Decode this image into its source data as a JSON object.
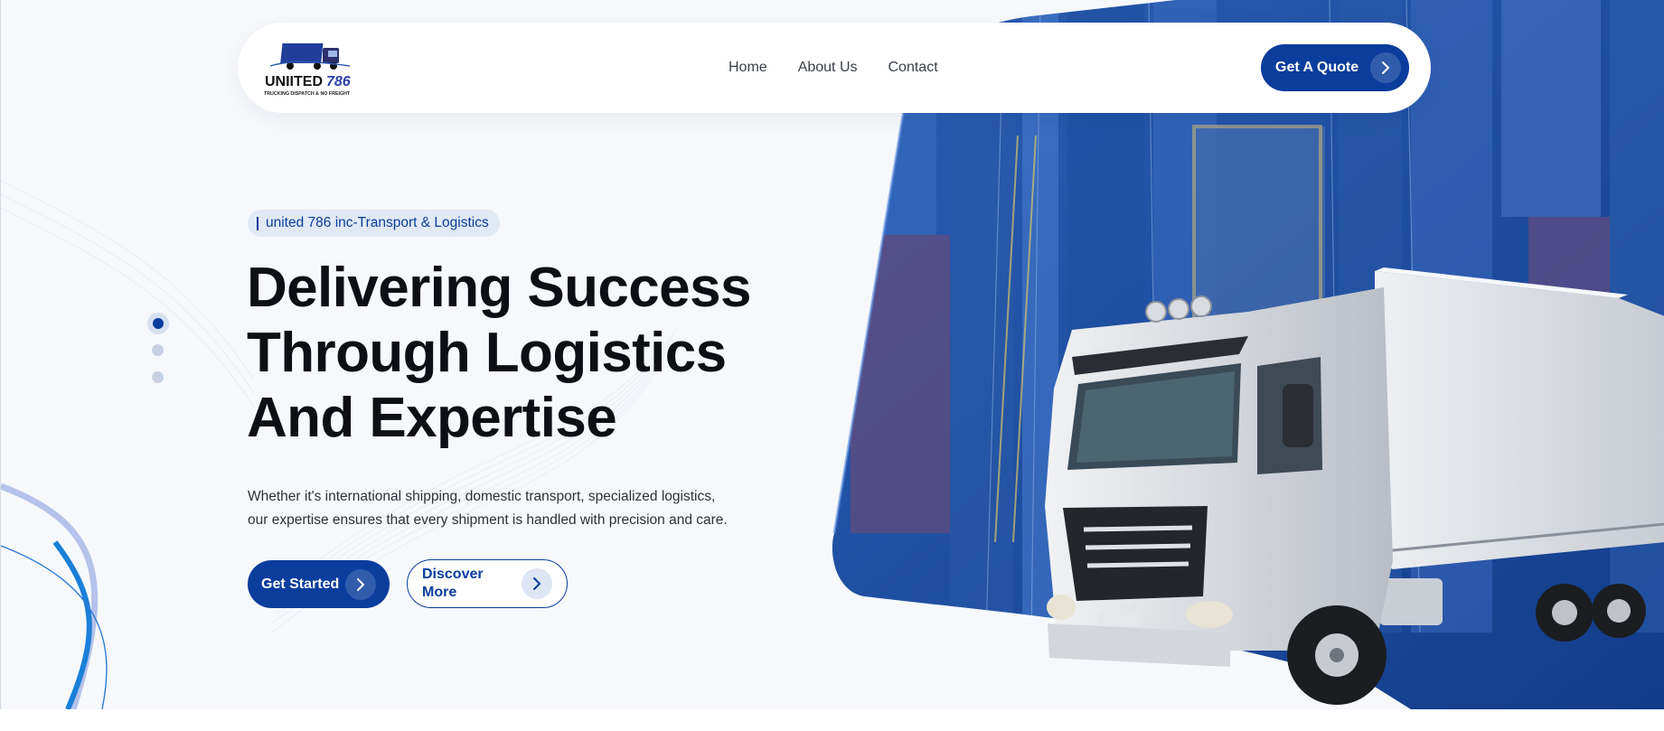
{
  "brand": {
    "name": "UNIITED 786",
    "tagline": "TRUCKING DISPATCH & NO FREIGHT"
  },
  "nav": {
    "items": [
      {
        "label": "Home"
      },
      {
        "label": "About Us"
      },
      {
        "label": "Contact"
      }
    ]
  },
  "header": {
    "quote_label": "Get A Quote"
  },
  "hero": {
    "tag": "united 786 inc-Transport & Logistics",
    "headline_lines": [
      "Delivering Success",
      "Through Logistics",
      "And Expertise"
    ],
    "subtext_lines": [
      "Whether it's international shipping, domestic transport, specialized logistics,",
      "our expertise ensures that every shipment is handled with precision and care."
    ],
    "primary_cta": "Get Started",
    "secondary_cta": "Discover More"
  },
  "slider": {
    "total": 3,
    "active_index": 0
  },
  "colors": {
    "brand_blue": "#0a3d9c",
    "headline": "#0d0f15",
    "background": "#f6f8fb",
    "dot_active": "#0a3d9c",
    "dot_inactive": "#c6d1e3"
  },
  "icons": {
    "cta_arrow": "chevron-right-icon"
  }
}
